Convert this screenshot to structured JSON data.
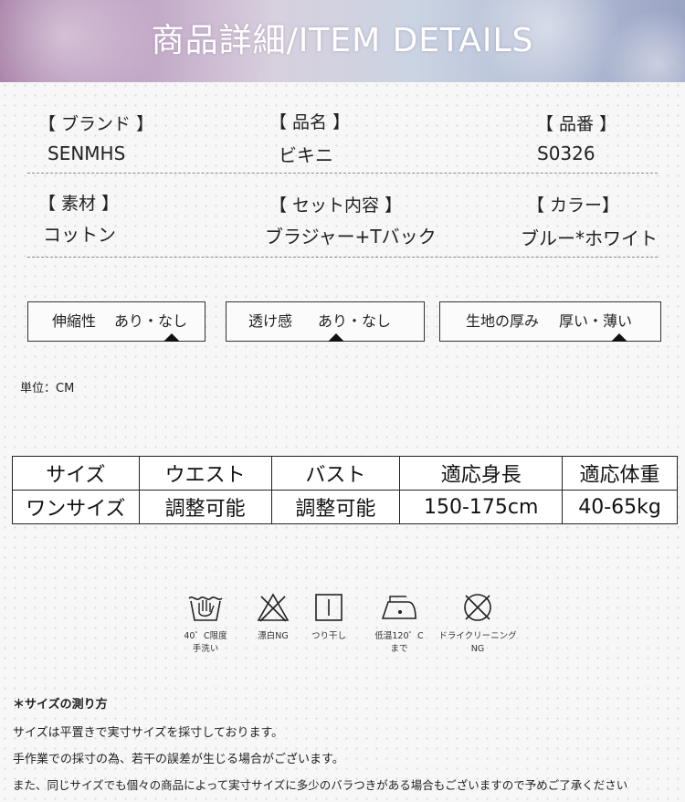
{
  "banner": {
    "title": "商品詳細/ITEM DETAILS"
  },
  "specs": [
    {
      "label": "【 ブランド 】",
      "value": "SENMHS"
    },
    {
      "label": "【 品名 】",
      "value": "ビキニ"
    },
    {
      "label": "【 品番 】",
      "value": "S0326"
    },
    {
      "label": "【 素材 】",
      "value": "コットン"
    },
    {
      "label": "【 セット内容 】",
      "value": "ブラジャー+Tバック"
    },
    {
      "label": "【 カラー】",
      "value": "ブルー*ホワイト"
    }
  ],
  "attributes": [
    {
      "name": "伸縮性",
      "options": "あり・なし",
      "selected": "なし"
    },
    {
      "name": "透け感",
      "options": "あり・なし",
      "selected": "あり"
    },
    {
      "name": "生地の厚み",
      "options": "厚い・薄い",
      "selected": "薄い"
    }
  ],
  "unit": "単位：CM",
  "size_table": {
    "headers": [
      "サイズ",
      "ウエスト",
      "バスト",
      "適応身長",
      "適応体重"
    ],
    "rows": [
      [
        "ワンサイズ",
        "調整可能",
        "調整可能",
        "150-175cm",
        "40-65kg"
      ]
    ]
  },
  "care": [
    {
      "icon": "hand-wash-40-icon",
      "label_lines": [
        "40゜C限度",
        "手洗い"
      ]
    },
    {
      "icon": "no-bleach-icon",
      "label_lines": [
        "漂白NG"
      ]
    },
    {
      "icon": "line-dry-icon",
      "label_lines": [
        "つり干し"
      ]
    },
    {
      "icon": "iron-low-temp-icon",
      "label_lines": [
        "低温120゜C",
        "まで"
      ]
    },
    {
      "icon": "no-dry-clean-icon",
      "label_lines": [
        "ドライクリーニング",
        "NG"
      ]
    }
  ],
  "notes": {
    "title": "＊サイズの測り方",
    "lines": [
      "サイズは平置きで実寸サイズを採寸しております。",
      "手作業での採寸の為、若干の誤差が生じる場合がございます。",
      "また、同じサイズでも個々の商品によって実寸サイズに多少のバラつきがある場合もございますので予めご了承ください"
    ]
  }
}
